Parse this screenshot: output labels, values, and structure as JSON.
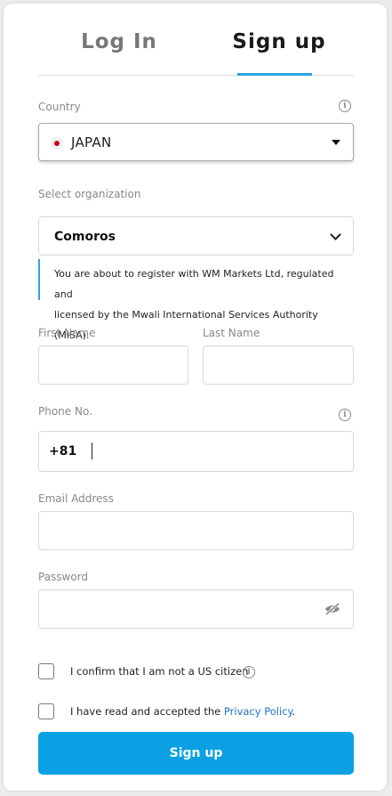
{
  "tabs": {
    "login": "Log In",
    "signup": "Sign up",
    "active": "signup"
  },
  "country": {
    "label": "Country",
    "value": "JAPAN",
    "flag": "japan-flag-icon"
  },
  "organization": {
    "label": "Select organization",
    "value": "Comoros",
    "notice_line1": "You are about to register with WM Markets Ltd, regulated and",
    "notice_line2": "licensed by the Mwali International Services Authority (MISA)."
  },
  "first_name": {
    "label": "First Name",
    "value": ""
  },
  "last_name": {
    "label": "Last Name",
    "value": ""
  },
  "phone": {
    "label": "Phone No.",
    "code": "+81",
    "value": ""
  },
  "email": {
    "label": "Email Address",
    "value": ""
  },
  "password": {
    "label": "Password",
    "value": ""
  },
  "checks": {
    "us_citizen": {
      "label": "I confirm that I am not a US citizen",
      "checked": false
    },
    "privacy": {
      "prefix": "I have read and accepted the ",
      "link": "Privacy Policy",
      "suffix": ".",
      "checked": false
    }
  },
  "submit": {
    "label": "Sign up"
  },
  "colors": {
    "accent": "#0aa0e3",
    "tab_underline": "#2aa4e0",
    "link": "#1f74c4"
  }
}
